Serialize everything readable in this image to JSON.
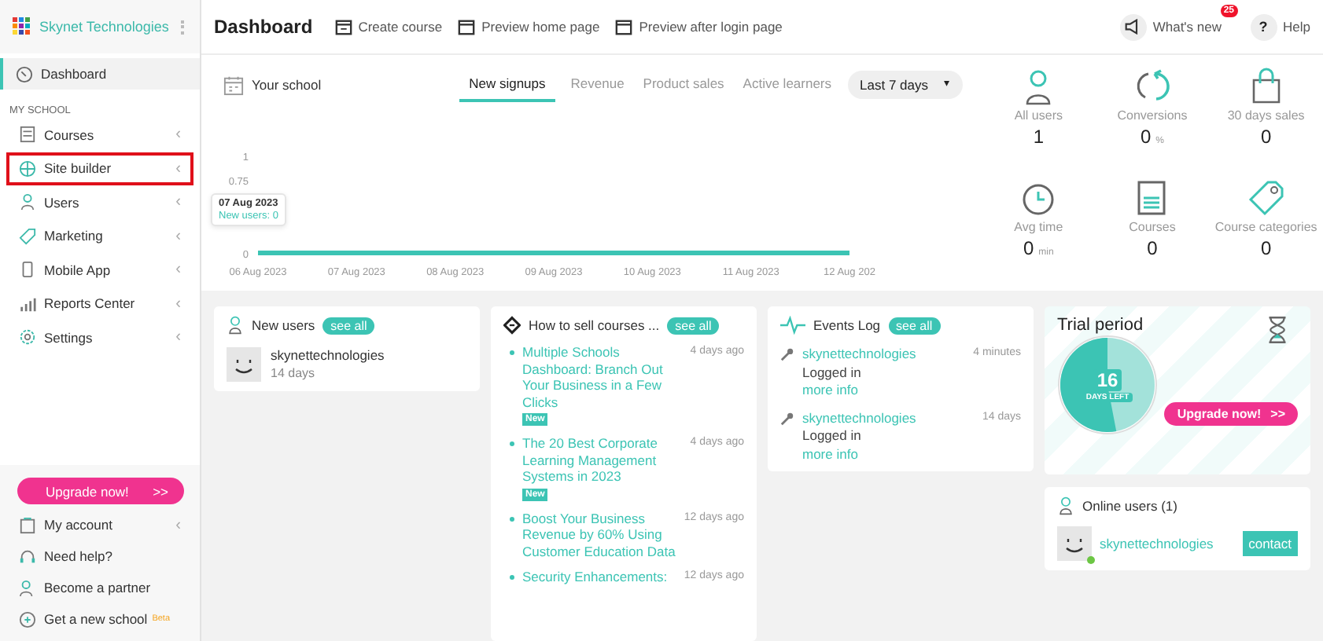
{
  "sidebar": {
    "brand": "Skynet Technologies",
    "top_items": [
      {
        "label": "Dashboard",
        "selected": true,
        "outlined": false
      }
    ],
    "section": "MY SCHOOL",
    "items": [
      {
        "label": "Courses",
        "selected": false,
        "outlined": false,
        "arrow": "‹"
      },
      {
        "label": "Site builder",
        "selected": false,
        "outlined": true,
        "arrow": "‹"
      },
      {
        "label": "Users",
        "selected": false,
        "outlined": false,
        "arrow": "‹"
      },
      {
        "label": "Marketing",
        "selected": false,
        "outlined": false,
        "arrow": "‹"
      },
      {
        "label": "Mobile App",
        "selected": false,
        "outlined": false,
        "arrow": "‹"
      },
      {
        "label": "Reports Center",
        "selected": false,
        "outlined": false,
        "arrow": "‹"
      },
      {
        "label": "Settings",
        "selected": false,
        "outlined": false,
        "arrow": "‹"
      }
    ],
    "upgrade": {
      "label": "Upgrade now!",
      "arrow": ">>"
    },
    "bottom_items": [
      {
        "label": "My account",
        "arrow": "‹"
      },
      {
        "label": "Need help?"
      },
      {
        "label": "Become a partner"
      },
      {
        "label": "Get a new school",
        "badge": "Beta"
      }
    ]
  },
  "topbar": {
    "title": "Dashboard",
    "actions": [
      "Create course",
      "Preview home page",
      "Preview after login page"
    ],
    "whats_new": {
      "label": "What's new",
      "badge": "25"
    },
    "help": {
      "glyph": "?",
      "label": "Help"
    }
  },
  "school": {
    "title": "Your school",
    "tabs": [
      {
        "label": "New signups",
        "selected": true
      },
      {
        "label": "Revenue",
        "selected": false
      },
      {
        "label": "Product sales",
        "selected": false
      },
      {
        "label": "Active learners",
        "selected": false
      }
    ],
    "range": {
      "label": "Last 7 days",
      "caret": "▾"
    },
    "tooltip": {
      "date": "07 Aug 2023",
      "text": "New users: 0"
    },
    "chart_data": {
      "type": "line",
      "categories": [
        "06 Aug 2023",
        "07 Aug 2023",
        "08 Aug 2023",
        "09 Aug 2023",
        "10 Aug 2023",
        "11 Aug 2023",
        "12 Aug 202"
      ],
      "yticks": [
        0,
        0.75,
        1
      ],
      "ylim": [
        0,
        1
      ],
      "series": [
        {
          "color": "#3cc4b4",
          "values": [
            0,
            0,
            0,
            0,
            0,
            0,
            0
          ]
        }
      ]
    }
  },
  "stats": [
    {
      "label": "All users",
      "value": "1"
    },
    {
      "label": "Conversions",
      "value": "0",
      "unit": "%"
    },
    {
      "label": "30 days sales",
      "value": "0"
    },
    {
      "label": "Avg time",
      "value": "0",
      "unit": "min"
    },
    {
      "label": "Courses",
      "value": "0"
    },
    {
      "label": "Course categories",
      "value": "0"
    }
  ],
  "new_users": {
    "title": "New users",
    "see_all": "see all",
    "users": [
      {
        "name": "skynettechnologies",
        "ago": "14 days"
      }
    ]
  },
  "blog": {
    "title": "How to sell courses ...",
    "see_all": "see all",
    "posts": [
      {
        "title": "Multiple Schools Dashboard: Branch Out Your Business in a Few Clicks",
        "ago": "4 days ago",
        "badge": "New"
      },
      {
        "title": "The 20 Best Corporate Learning Management Systems in 2023",
        "ago": "4 days ago",
        "badge": "New"
      },
      {
        "title": "Boost Your Business Revenue by 60% Using Customer Education Data",
        "ago": "12 days ago"
      },
      {
        "title": "Security Enhancements:",
        "ago": "12 days ago"
      }
    ]
  },
  "events": {
    "title": "Events Log",
    "see_all": "see all",
    "items": [
      {
        "user": "skynettechnologies",
        "action": "Logged in",
        "link": "more info",
        "ago": "4 minutes"
      },
      {
        "user": "skynettechnologies",
        "action": "Logged in",
        "link": "more info",
        "ago": "14 days"
      }
    ]
  },
  "trial": {
    "title": "Trial period",
    "days": "16",
    "days_label": "DAYS LEFT",
    "level": 0.53,
    "upgrade": "Upgrade now!",
    "arrow": ">>"
  },
  "online": {
    "title": "Online users (1)",
    "users": [
      {
        "name": "skynettechnologies",
        "online": true,
        "contact": "contact"
      }
    ]
  }
}
